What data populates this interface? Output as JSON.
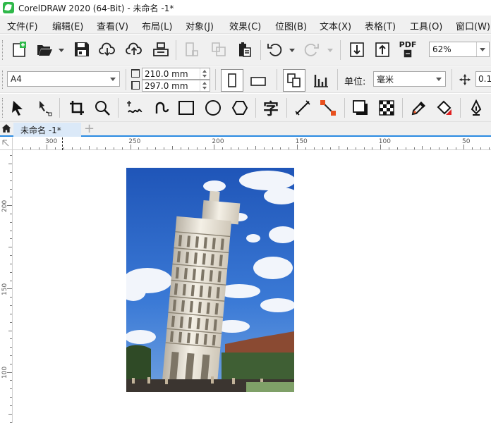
{
  "window": {
    "title": "CorelDRAW 2020 (64-Bit) - 未命名 -1*"
  },
  "menu": [
    {
      "label": "文件(F)"
    },
    {
      "label": "编辑(E)"
    },
    {
      "label": "查看(V)"
    },
    {
      "label": "布局(L)"
    },
    {
      "label": "对象(J)"
    },
    {
      "label": "效果(C)"
    },
    {
      "label": "位图(B)"
    },
    {
      "label": "文本(X)"
    },
    {
      "label": "表格(T)"
    },
    {
      "label": "工具(O)"
    },
    {
      "label": "窗口(W)"
    }
  ],
  "standard_toolbar": {
    "zoom_value": "62%",
    "pdf_label": "PDF"
  },
  "property_bar": {
    "page_size": "A4",
    "width": "210.0 mm",
    "height": "297.0 mm",
    "units_label": "单位:",
    "units_value": "毫米",
    "nudge_value": "0.1"
  },
  "tools": {
    "text_tool_glyph": "字"
  },
  "document_tab": {
    "label": "未命名 -1*",
    "add_tab": "+"
  },
  "ruler": {
    "h_labels": [
      "300",
      "250",
      "200",
      "150",
      "100",
      "50"
    ],
    "v_labels": [
      "200",
      "150",
      "100"
    ]
  },
  "colors": {
    "accent": "#2a8ae2",
    "toolbar_bg": "#f0f0f0",
    "tab_bg": "#dbe9f8"
  }
}
